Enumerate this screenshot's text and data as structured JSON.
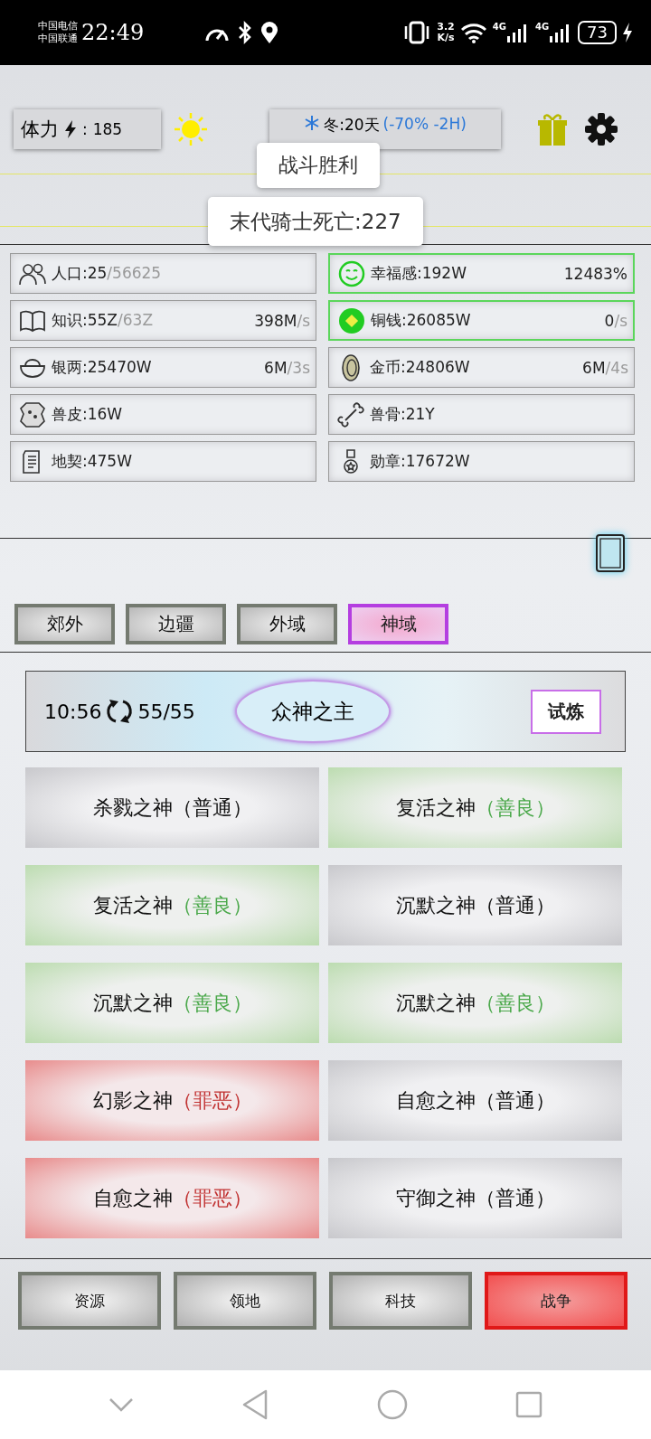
{
  "status_bar": {
    "carriers": [
      "中国电信",
      "中国联通"
    ],
    "time": "22:49",
    "speed": "3.2\nK/s",
    "networks": [
      "4G",
      "4G"
    ],
    "battery": "73"
  },
  "header": {
    "stamina_label": "体力",
    "stamina_sep": ":",
    "stamina": "185",
    "season": "冬:20天",
    "season_effect": "(-70% -2H)"
  },
  "toasts": [
    "战斗胜利",
    "末代骑士死亡:227"
  ],
  "stats": [
    {
      "label": "人口:25",
      "extra": "/56625",
      "highlighted": false
    },
    {
      "label": "幸福感:192W",
      "rate": "12483%",
      "highlighted": true
    },
    {
      "label": "知识:55Z",
      "extra": "/63Z",
      "rate": "398M",
      "rate_unit": "/s",
      "highlighted": false
    },
    {
      "label": "铜钱:26085W",
      "rate": "0",
      "rate_unit": "/s",
      "highlighted": true
    },
    {
      "label": "银两:25470W",
      "rate": "6M",
      "rate_unit": "/3s",
      "highlighted": false
    },
    {
      "label": "金币:24806W",
      "rate": "6M",
      "rate_unit": "/4s",
      "highlighted": false
    },
    {
      "label": "兽皮:16W",
      "highlighted": false
    },
    {
      "label": "兽骨:21Y",
      "highlighted": false
    },
    {
      "label": "地契:475W",
      "highlighted": false
    },
    {
      "label": "勋章:17672W",
      "highlighted": false
    }
  ],
  "region_tabs": [
    {
      "label": "郊外",
      "selected": false
    },
    {
      "label": "边疆",
      "selected": false
    },
    {
      "label": "外域",
      "selected": false
    },
    {
      "label": "神域",
      "selected": true
    }
  ],
  "banner": {
    "timer": "10:56",
    "count": "55/55",
    "boss": "众神之主",
    "action": "试炼"
  },
  "gods": [
    {
      "name": "杀戮之神",
      "tag": "（普通）",
      "kind": "normal"
    },
    {
      "name": "复活之神",
      "tag": "（善良）",
      "kind": "good"
    },
    {
      "name": "复活之神",
      "tag": "（善良）",
      "kind": "good"
    },
    {
      "name": "沉默之神",
      "tag": "（普通）",
      "kind": "normal"
    },
    {
      "name": "沉默之神",
      "tag": "（善良）",
      "kind": "good"
    },
    {
      "name": "沉默之神",
      "tag": "（善良）",
      "kind": "good"
    },
    {
      "name": "幻影之神",
      "tag": "（罪恶）",
      "kind": "evil"
    },
    {
      "name": "自愈之神",
      "tag": "（普通）",
      "kind": "normal"
    },
    {
      "name": "自愈之神",
      "tag": "（罪恶）",
      "kind": "evil"
    },
    {
      "name": "守御之神",
      "tag": "（普通）",
      "kind": "normal"
    }
  ],
  "bottom_nav": [
    {
      "label": "资源",
      "selected": false
    },
    {
      "label": "领地",
      "selected": false
    },
    {
      "label": "科技",
      "selected": false
    },
    {
      "label": "战争",
      "selected": true
    }
  ]
}
